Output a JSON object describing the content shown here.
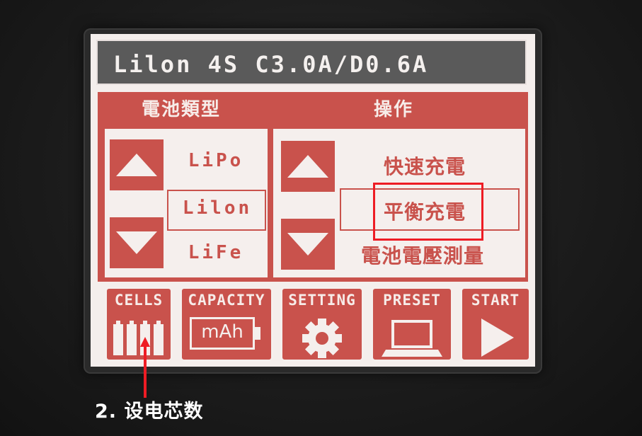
{
  "title": "Lilon 4S C3.0A/D0.6A",
  "battery_type": {
    "header": "電池類型",
    "options": [
      "LiPo",
      "Lilon",
      "LiFe"
    ],
    "selected": "Lilon"
  },
  "operation": {
    "header": "操作",
    "options": [
      "快速充電",
      "平衡充電",
      "電池電壓測量"
    ],
    "selected": "平衡充電"
  },
  "toolbar": {
    "cells_label": "CELLS",
    "capacity_label": "CAPACITY",
    "capacity_unit": "mAh",
    "setting_label": "SETTING",
    "preset_label": "PRESET",
    "start_label": "START"
  },
  "annotation": {
    "text": "2. 设电芯数",
    "highlight_color": "#ee1c24"
  },
  "colors": {
    "accent": "#c9524c",
    "screen_bg": "#f4eeec",
    "title_bg": "#5a5a5a"
  }
}
